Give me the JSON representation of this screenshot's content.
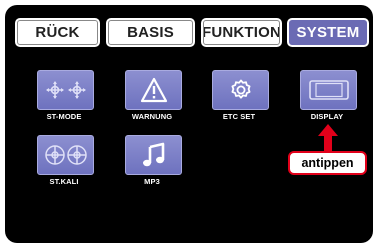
{
  "tabs": [
    {
      "label": "RÜCK",
      "active": false
    },
    {
      "label": "BASIS",
      "active": false
    },
    {
      "label": "FUNKTION",
      "active": false
    },
    {
      "label": "SYSTEM",
      "active": true
    }
  ],
  "menu_items": [
    {
      "label": "ST-MODE",
      "icon": "stick-mode-icon"
    },
    {
      "label": "WARNUNG",
      "icon": "warning-icon"
    },
    {
      "label": "ETC SET",
      "icon": "gear-icon"
    },
    {
      "label": "DISPLAY",
      "icon": "display-icon"
    },
    {
      "label": "ST.KALI",
      "icon": "stick-calibration-icon"
    },
    {
      "label": "MP3",
      "icon": "music-note-icon"
    }
  ],
  "callout": {
    "text": "antippen"
  },
  "colors": {
    "tab_active": "#6b6bb4",
    "tile": "#7a7ec6",
    "callout_border": "#e2001a",
    "arrow": "#e2001a",
    "screen_bg": "#000000"
  }
}
